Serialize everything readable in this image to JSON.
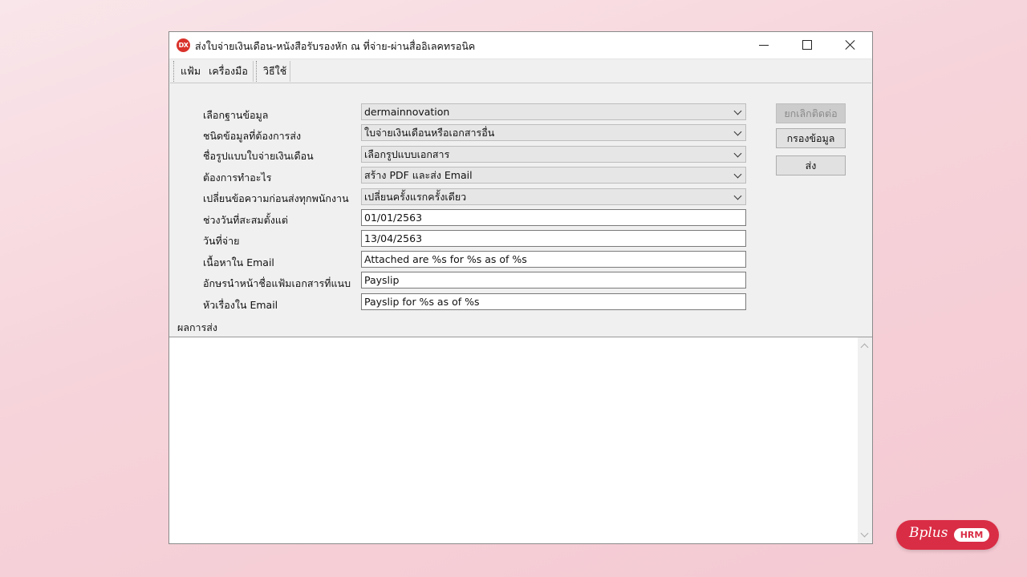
{
  "window": {
    "app_icon_text": "DX",
    "title": "ส่งใบจ่ายเงินเดือน-หนังสือรับรองหัก ณ ที่จ่าย-ผ่านสื่ออิเลคทรอนิค"
  },
  "menu": {
    "file": "แฟ้ม",
    "tools": "เครื่องมือ",
    "howto": "วิธีใช้"
  },
  "form": {
    "database": {
      "label": "เลือกฐานข้อมูล",
      "value": "dermainnovation"
    },
    "data_type": {
      "label": "ชนิดข้อมูลที่ต้องการส่ง",
      "value": "ใบจ่ายเงินเดือนหรือเอกสารอื่น"
    },
    "payslip_format": {
      "label": "ชื่อรูปแบบใบจ่ายเงินเดือน",
      "value": "เลือกรูปแบบเอกสาร"
    },
    "action": {
      "label": "ต้องการทำอะไร",
      "value": "สร้าง PDF และส่ง Email"
    },
    "change_message": {
      "label": "เปลี่ยนข้อความก่อนส่งทุกพนักงาน",
      "value": "เปลี่ยนครั้งแรกครั้งเดียว"
    },
    "accum_from": {
      "label": "ช่วงวันที่สะสมตั้งแต่",
      "value": "01/01/2563"
    },
    "pay_date": {
      "label": "วันที่จ่าย",
      "value": "13/04/2563"
    },
    "email_body": {
      "label": "เนื้อหาใน Email",
      "value": "Attached are %s for %s as of %s"
    },
    "file_prefix": {
      "label": "อักษรนำหน้าชื่อแฟ้มเอกสารที่แนบ",
      "value": "Payslip"
    },
    "email_subject": {
      "label": "หัวเรื่องใน Email",
      "value": "Payslip for %s as of %s"
    }
  },
  "buttons": {
    "cancel_connect": "ยกเลิกติดต่อ",
    "filter": "กรองข้อมูล",
    "send": "ส่ง"
  },
  "result": {
    "label": "ผลการส่ง"
  },
  "logo": {
    "script": "Bplus",
    "badge": "HRM"
  }
}
